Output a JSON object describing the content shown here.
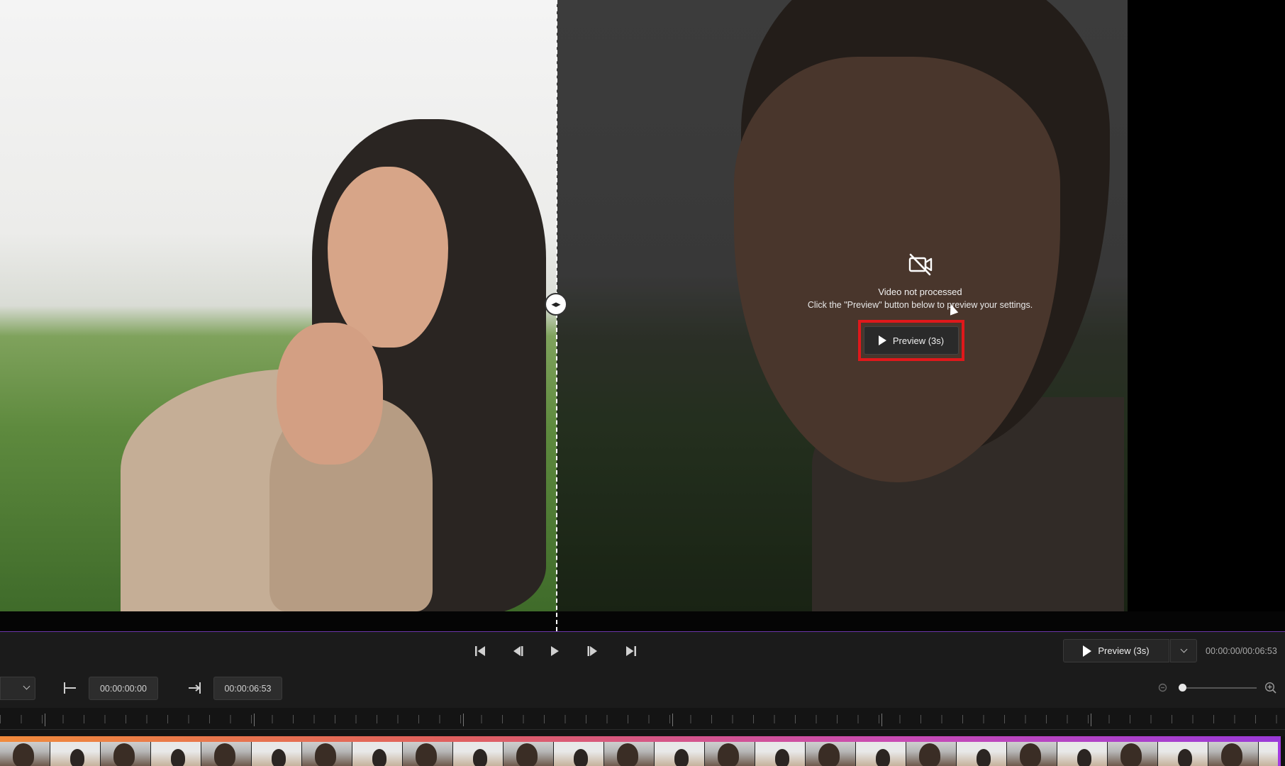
{
  "overlay": {
    "icon": "video-off-icon",
    "title": "Video not processed",
    "description": "Click the \"Preview\" button below to preview your settings.",
    "preview_button_label": "Preview (3s)",
    "highlight_color": "#e0181b"
  },
  "split": {
    "handle_icon": "split-drag-handle-icon",
    "handle_glyph": "◂▸"
  },
  "transport": {
    "buttons": [
      "skip-to-start-icon",
      "step-back-icon",
      "play-icon",
      "step-forward-icon",
      "skip-to-end-icon"
    ],
    "preview_label": "Preview (3s)",
    "time_readout": "00:00:00/00:06:53"
  },
  "inout": {
    "in_time": "00:00:00:00",
    "out_time": "00:00:06:53",
    "zoom_level": 0.0
  },
  "colors": {
    "accent": "#9a3ad8",
    "track_gradient_start": "#f08a3c",
    "panel_bg": "#1b1b1b"
  }
}
